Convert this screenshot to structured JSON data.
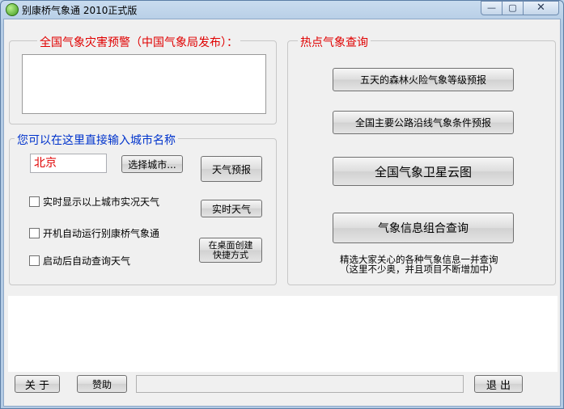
{
  "window": {
    "title": "别康桥气象通 2010正式版"
  },
  "warning_group": {
    "title": "全国气象灾害预警（中国气象局发布）："
  },
  "city_group": {
    "title": "您可以在这里直接输入城市名称",
    "city_value": "北京",
    "select_city_label": "选择城市...",
    "forecast_label": "天气预报",
    "realtime_label": "实时天气",
    "shortcut_label": "在桌面创建快捷方式",
    "checks": [
      {
        "label": "实时显示以上城市实况天气",
        "checked": false
      },
      {
        "label": "开机自动运行别康桥气象通",
        "checked": false
      },
      {
        "label": "启动后自动查询天气",
        "checked": false
      }
    ]
  },
  "hot_group": {
    "title": "热点气象查询",
    "forest_fire_label": "五天的森林火险气象等级预报",
    "highway_label": "全国主要公路沿线气象条件预报",
    "satellite_label": "全国气象卫星云图",
    "combo_label": "气象信息组合查询",
    "info_line1": "精选大家关心的各种气象信息一并查询",
    "info_line2": "（这里不少奥，并且项目不断增加中）"
  },
  "bottom": {
    "about_label": "关 于",
    "donate_label": "赞助",
    "exit_label": "退 出",
    "progress": 0
  },
  "colors": {
    "accent_red": "#e00000",
    "label_blue": "#0033cc"
  }
}
